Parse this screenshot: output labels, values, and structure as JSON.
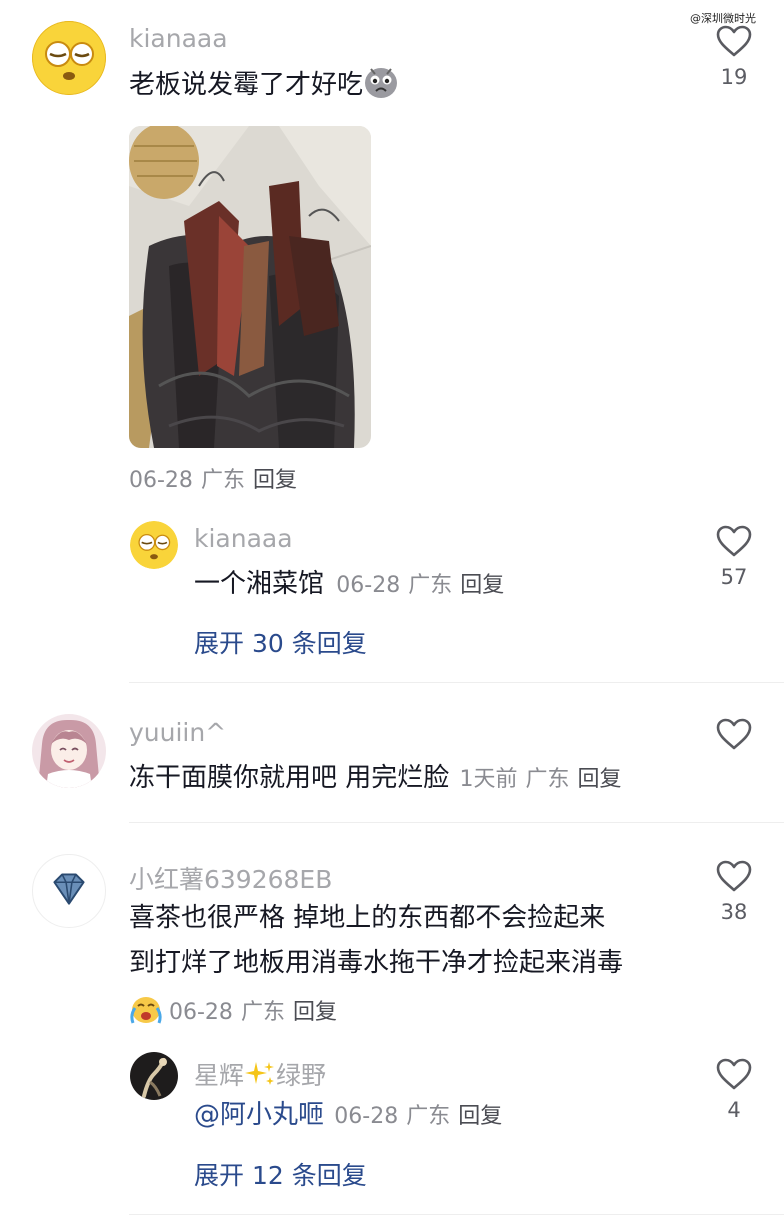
{
  "watermark": "@深圳微时光",
  "comments": [
    {
      "username": "kianaaa",
      "text": "老板说发霉了才好吃",
      "date": "06-28",
      "location": "广东",
      "reply_label": "回复",
      "likes": "19",
      "avatar_icon": "dizzy-face-emoji-icon",
      "emoji_icon": "crying-face-emoji-icon",
      "image": "cured-meat-in-black-bag-photo",
      "replies": [
        {
          "username": "kianaaa",
          "text": "一个湘菜馆",
          "date": "06-28",
          "location": "广东",
          "reply_label": "回复",
          "likes": "57"
        }
      ],
      "expand_label": "展开 30 条回复"
    },
    {
      "username": "yuuiin^",
      "text": "冻干面膜你就用吧 用完烂脸",
      "date": "1天前",
      "location": "广东",
      "reply_label": "回复",
      "likes": ""
    },
    {
      "username": "小红薯639268EB",
      "text_line1": "喜茶也很严格 掉地上的东西都不会捡起来",
      "text_line2": "到打烊了地板用消毒水拖干净才捡起来消毒",
      "date": "06-28",
      "location": "广东",
      "reply_label": "回复",
      "likes": "38",
      "avatar_icon": "diamond-icon",
      "emoji_icon": "loudly-crying-emoji-icon",
      "replies": [
        {
          "username_part1": "星辉",
          "username_part2": "绿野",
          "text": "@阿小丸咂",
          "date": "06-28",
          "location": "广东",
          "reply_label": "回复",
          "likes": "4"
        }
      ],
      "expand_label": "展开 12 条回复"
    }
  ]
}
